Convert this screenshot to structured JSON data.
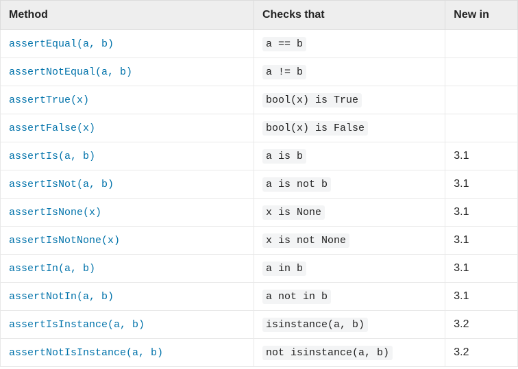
{
  "table": {
    "headers": {
      "method": "Method",
      "checks": "Checks that",
      "newin": "New in"
    },
    "rows": [
      {
        "method": "assertEqual(a, b)",
        "checks": "a == b",
        "newin": ""
      },
      {
        "method": "assertNotEqual(a, b)",
        "checks": "a != b",
        "newin": ""
      },
      {
        "method": "assertTrue(x)",
        "checks": "bool(x) is True",
        "newin": ""
      },
      {
        "method": "assertFalse(x)",
        "checks": "bool(x) is False",
        "newin": ""
      },
      {
        "method": "assertIs(a, b)",
        "checks": "a is b",
        "newin": "3.1"
      },
      {
        "method": "assertIsNot(a, b)",
        "checks": "a is not b",
        "newin": "3.1"
      },
      {
        "method": "assertIsNone(x)",
        "checks": "x is None",
        "newin": "3.1"
      },
      {
        "method": "assertIsNotNone(x)",
        "checks": "x is not None",
        "newin": "3.1"
      },
      {
        "method": "assertIn(a, b)",
        "checks": "a in b",
        "newin": "3.1"
      },
      {
        "method": "assertNotIn(a, b)",
        "checks": "a not in b",
        "newin": "3.1"
      },
      {
        "method": "assertIsInstance(a, b)",
        "checks": "isinstance(a, b)",
        "newin": "3.2"
      },
      {
        "method": "assertNotIsInstance(a, b)",
        "checks": "not isinstance(a, b)",
        "newin": "3.2"
      }
    ]
  }
}
